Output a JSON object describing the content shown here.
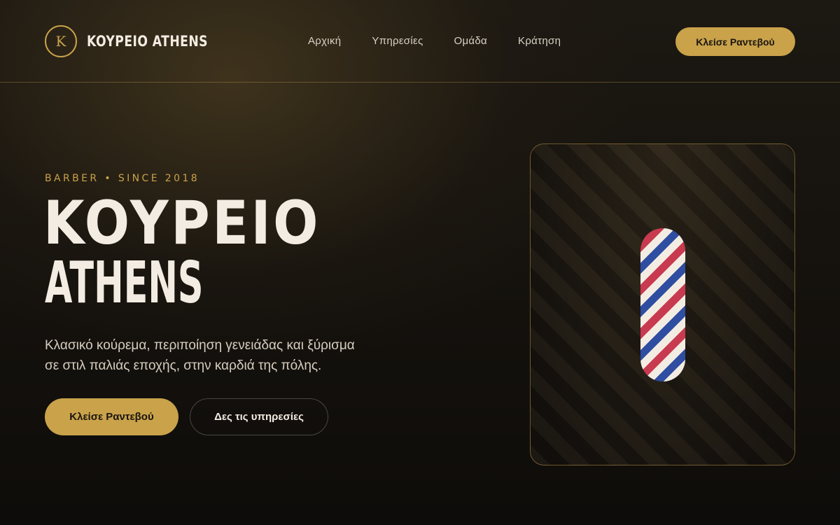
{
  "header": {
    "logo_letter": "K",
    "brand": "KOYPEIO ATHENS",
    "nav": [
      "Αρχική",
      "Υπηρεσίες",
      "Ομάδα",
      "Κράτηση"
    ],
    "cta": "Κλείσε Ραντεβού"
  },
  "hero": {
    "eyebrow": "BARBER • SINCE 2018",
    "title_line1": "KOYPEIO",
    "title_line2": "ATHENS",
    "description_line1": "Κλασικό κούρεμα, περιποίηση γενειάδας και ξύρισμα",
    "description_line2": "σε στιλ παλιάς εποχής, στην καρδιά της πόλης.",
    "primary_button": "Κλείσε Ραντεβού",
    "secondary_button": "Δες τις υπηρεσίες"
  },
  "colors": {
    "accent": "#c9a24a",
    "text": "#f3ece2",
    "pole_red": "#c83a4f",
    "pole_blue": "#2f4ea1"
  },
  "icons": {
    "logo": "k-monogram-icon",
    "visual": "barber-pole-icon"
  }
}
